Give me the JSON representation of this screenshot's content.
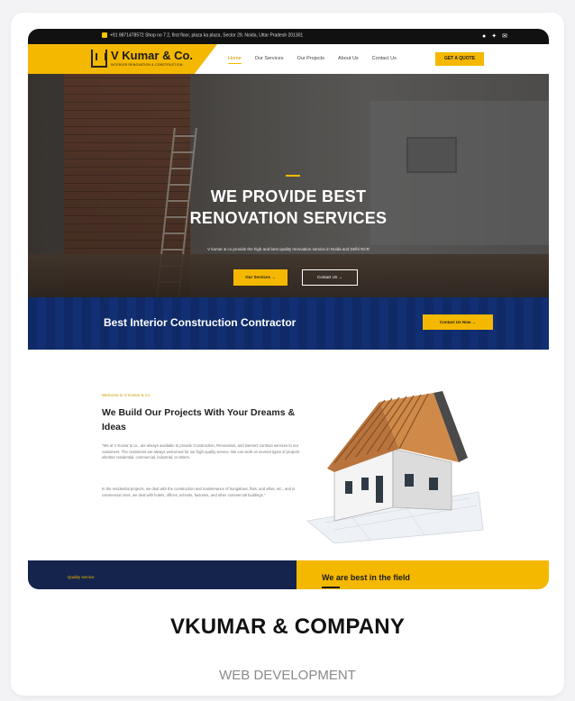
{
  "site": {
    "topbar": {
      "contact": "+91 9871478572   Shop no 7 2, first floor, plaza ka plaza, Sector 29, Noida, Uttar Pradesh 201301",
      "social_icons": [
        "social-icon-1",
        "twitter-icon",
        "mail-icon"
      ]
    },
    "logo": {
      "name": "V Kumar & Co.",
      "tagline": "INTERIOR RENOVATION & CONSTRUCTION"
    },
    "nav": [
      "Home",
      "Our Services",
      "Our Projects",
      "About Us",
      "Contact Us"
    ],
    "quote_button": "GET A QUOTE",
    "hero": {
      "title_line1": "WE PROVIDE BEST",
      "title_line2": "RENOVATION SERVICES",
      "subtitle": "V kumar & co provide the high and best quality renovation service in Noida and Delhi NCR",
      "btn_primary": "Our Services →",
      "btn_secondary": "Contact Us →"
    },
    "band": {
      "title": "Best Interior Construction Contractor",
      "button": "Contact Us Now →"
    },
    "about": {
      "welcome": "Welcome to V Kumar & Co",
      "title": "We Build Our Projects With Your Dreams & Ideas",
      "para1": "\"We at V Kumar & co., are always available to provide Construction, Renovation, and interiors contract services to our customers. The customers are always welcomed for our high-quality service. We can work on several types of projects whether residential, commercial, industrial, or others.",
      "para2": "In the residential projects, we deal with the construction and maintenance of bungalows, flats, and villas, etc., and in commercial ones, we deal with hotels, offices, schools, factories, and other commercial buildings.\""
    },
    "strip": {
      "left_label": "Quality service",
      "right_title": "We are best in the field"
    }
  },
  "card": {
    "title": "VKUMAR & COMPANY",
    "category": "WEB DEVELOPMENT"
  },
  "colors": {
    "accent": "#f5b800",
    "navy": "#0f2a66",
    "dark": "#111111"
  }
}
